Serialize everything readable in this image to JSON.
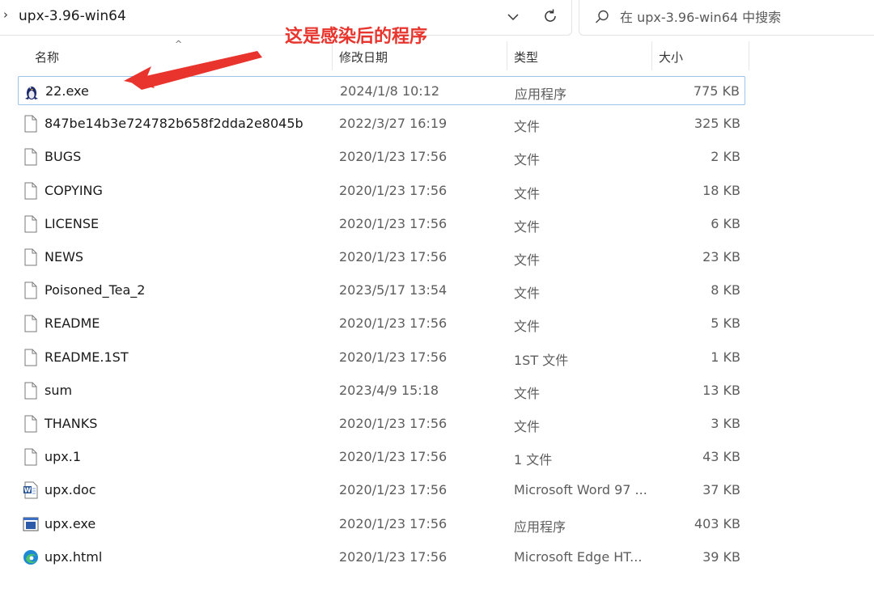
{
  "address_bar": {
    "separator": "›",
    "breadcrumb": "upx-3.96-win64"
  },
  "search": {
    "placeholder": "在 upx-3.96-win64 中搜索"
  },
  "columns": {
    "name": "名称",
    "modified": "修改日期",
    "type": "类型",
    "size": "大小"
  },
  "annotation": {
    "text": "这是感染后的程序",
    "color": "#e8342d"
  },
  "files": [
    {
      "name": "22.exe",
      "modified": "2024/1/8 10:12",
      "type": "应用程序",
      "size": "775 KB",
      "icon": "penguin-app-icon",
      "selected": true
    },
    {
      "name": "847be14b3e724782b658f2dda2e8045b",
      "modified": "2022/3/27 16:19",
      "type": "文件",
      "size": "325 KB",
      "icon": "file-icon"
    },
    {
      "name": "BUGS",
      "modified": "2020/1/23 17:56",
      "type": "文件",
      "size": "2 KB",
      "icon": "file-icon"
    },
    {
      "name": "COPYING",
      "modified": "2020/1/23 17:56",
      "type": "文件",
      "size": "18 KB",
      "icon": "file-icon"
    },
    {
      "name": "LICENSE",
      "modified": "2020/1/23 17:56",
      "type": "文件",
      "size": "6 KB",
      "icon": "file-icon"
    },
    {
      "name": "NEWS",
      "modified": "2020/1/23 17:56",
      "type": "文件",
      "size": "23 KB",
      "icon": "file-icon"
    },
    {
      "name": "Poisoned_Tea_2",
      "modified": "2023/5/17 13:54",
      "type": "文件",
      "size": "8 KB",
      "icon": "file-icon"
    },
    {
      "name": "README",
      "modified": "2020/1/23 17:56",
      "type": "文件",
      "size": "5 KB",
      "icon": "file-icon"
    },
    {
      "name": "README.1ST",
      "modified": "2020/1/23 17:56",
      "type": "1ST 文件",
      "size": "1 KB",
      "icon": "file-icon"
    },
    {
      "name": "sum",
      "modified": "2023/4/9 15:18",
      "type": "文件",
      "size": "13 KB",
      "icon": "file-icon"
    },
    {
      "name": "THANKS",
      "modified": "2020/1/23 17:56",
      "type": "文件",
      "size": "3 KB",
      "icon": "file-icon"
    },
    {
      "name": "upx.1",
      "modified": "2020/1/23 17:56",
      "type": "1 文件",
      "size": "43 KB",
      "icon": "file-icon"
    },
    {
      "name": "upx.doc",
      "modified": "2020/1/23 17:56",
      "type": "Microsoft Word 97 ...",
      "size": "37 KB",
      "icon": "word-doc-icon"
    },
    {
      "name": "upx.exe",
      "modified": "2020/1/23 17:56",
      "type": "应用程序",
      "size": "403 KB",
      "icon": "exe-app-icon"
    },
    {
      "name": "upx.html",
      "modified": "2020/1/23 17:56",
      "type": "Microsoft Edge HT...",
      "size": "39 KB",
      "icon": "edge-icon"
    }
  ]
}
